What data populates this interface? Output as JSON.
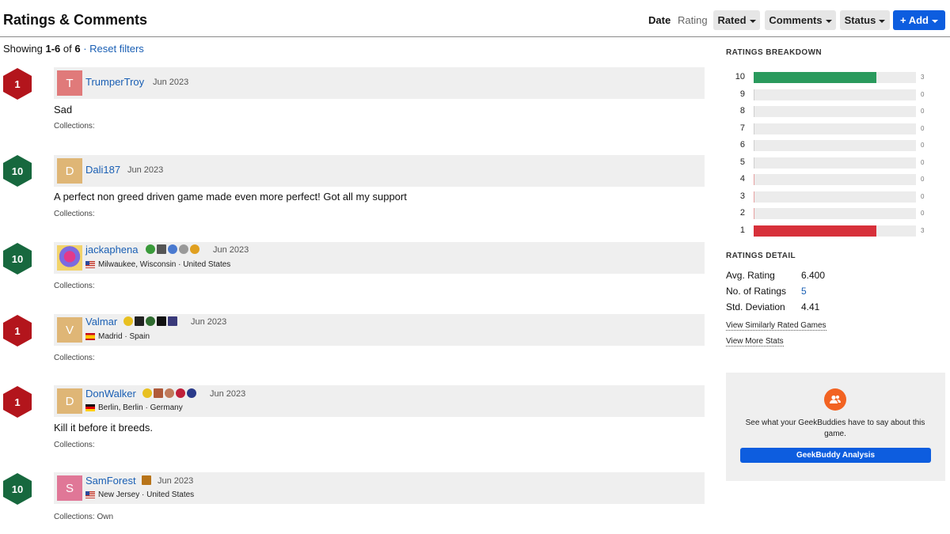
{
  "header": {
    "title": "Ratings & Comments",
    "sort_date": "Date",
    "sort_rating": "Rating",
    "rated_label": "Rated",
    "comments_label": "Comments",
    "status_label": "Status",
    "add_label": "+ Add"
  },
  "showing": {
    "prefix": "Showing ",
    "range": "1-6",
    "of": " of ",
    "total": "6",
    "sep": " · ",
    "reset": "Reset filters"
  },
  "comments": [
    {
      "rating": "1",
      "avatar_letter": "T",
      "avatar_color": "#e07a7a",
      "user": "TrumperTroy",
      "date": "Jun 2023",
      "location": "",
      "text": "Sad",
      "collections": "Collections:"
    },
    {
      "rating": "10",
      "avatar_letter": "D",
      "avatar_color": "#dfb676",
      "user": "Dali187",
      "date": "Jun 2023",
      "location": "",
      "text": "A perfect non greed driven game made even more perfect! Got all my support",
      "collections": "Collections:"
    },
    {
      "rating": "10",
      "avatar_letter": "",
      "avatar_color": "",
      "user": "jackaphena",
      "date": "Jun 2023",
      "location": "Milwaukee, Wisconsin · United States",
      "text": "",
      "collections": "Collections:"
    },
    {
      "rating": "1",
      "avatar_letter": "V",
      "avatar_color": "#dfb676",
      "user": "Valmar",
      "date": "Jun 2023",
      "location": "Madrid · Spain",
      "text": "",
      "collections": "Collections:"
    },
    {
      "rating": "1",
      "avatar_letter": "D",
      "avatar_color": "#dfb676",
      "user": "DonWalker",
      "date": "Jun 2023",
      "location": "Berlin, Berlin · Germany",
      "text": "Kill it before it breeds.",
      "collections": "Collections:"
    },
    {
      "rating": "10",
      "avatar_letter": "S",
      "avatar_color": "#e07797",
      "user": "SamForest",
      "date": "Jun 2023",
      "location": "New Jersey · United States",
      "text": "",
      "collections": "Collections: Own"
    }
  ],
  "sidebar": {
    "breakdown_heading": "RATINGS BREAKDOWN",
    "detail_heading": "RATINGS DETAIL",
    "avg_label": "Avg. Rating",
    "avg_value": "6.400",
    "num_label": "No. of Ratings",
    "num_value": "5",
    "std_label": "Std. Deviation",
    "std_value": "4.41",
    "link_similar": "View Similarly Rated Games",
    "link_more": "View More Stats",
    "buddy_text": "See what your GeekBuddies have to say about this game.",
    "buddy_button": "GeekBuddy Analysis"
  },
  "chart_data": {
    "type": "bar",
    "categories": [
      "10",
      "9",
      "8",
      "7",
      "6",
      "5",
      "4",
      "3",
      "2",
      "1"
    ],
    "values": [
      3,
      0,
      0,
      0,
      0,
      0,
      0,
      0,
      0,
      3
    ],
    "colors": [
      "#2a9a5d",
      "#cfcfcf",
      "#cfcfcf",
      "#cfcfcf",
      "#cfcfcf",
      "#cfcfcf",
      "#e7a0a0",
      "#e7a0a0",
      "#e7a0a0",
      "#d7303a"
    ],
    "max": 4
  },
  "colors": {
    "accent": "#0d5ddf",
    "link": "#1a5fb4",
    "bad": "#b3151c",
    "good": "#17683e"
  }
}
